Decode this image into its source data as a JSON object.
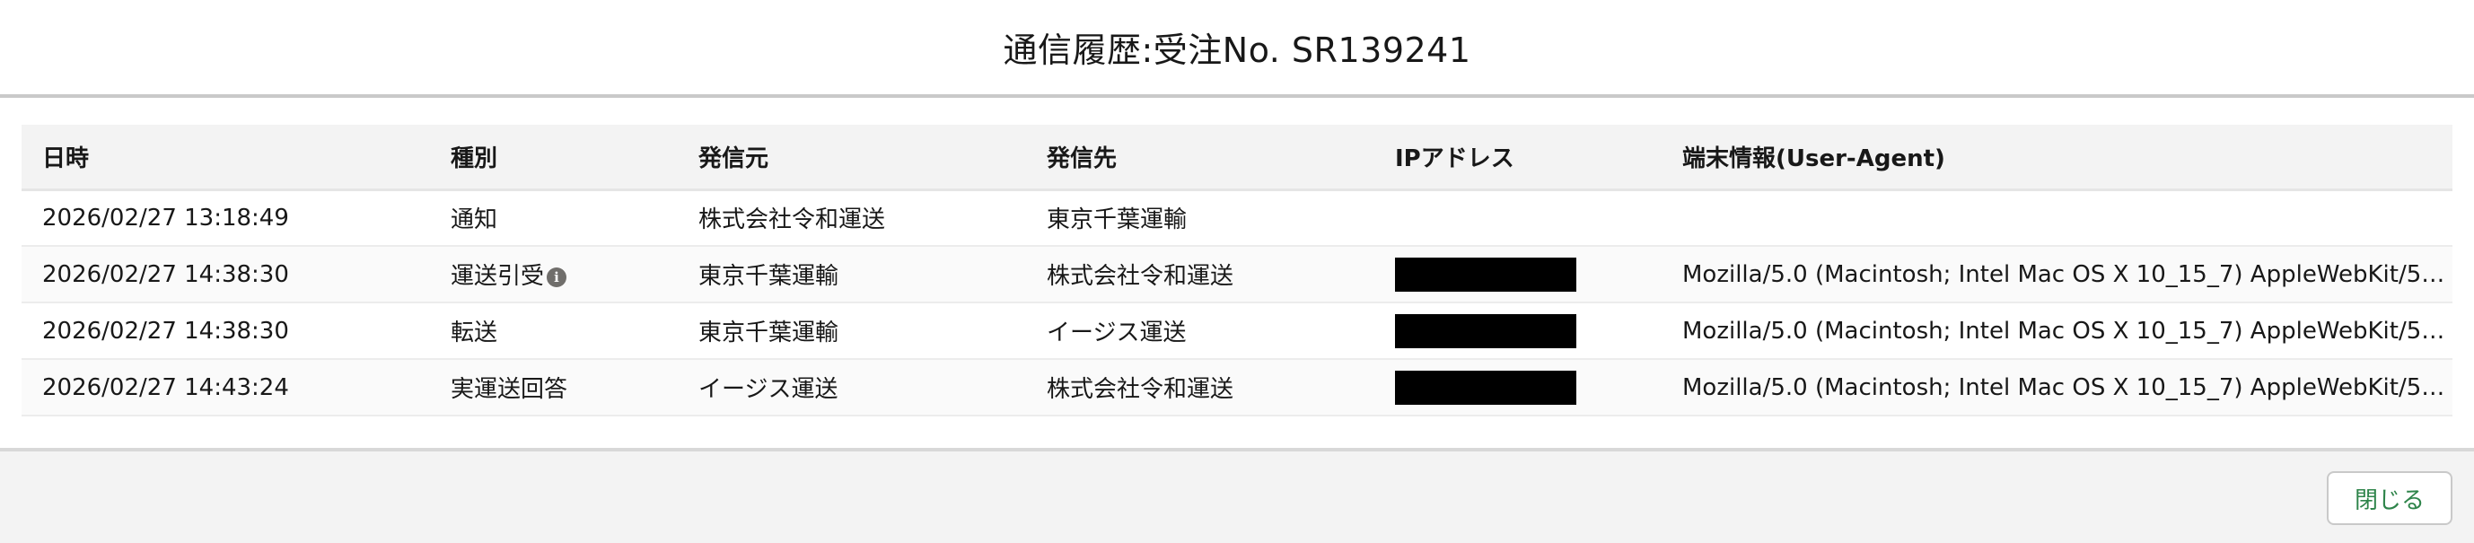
{
  "modal": {
    "title": "通信履歴:受注No. SR139241",
    "close_label": "閉じる"
  },
  "table": {
    "columns": [
      "日時",
      "種別",
      "発信元",
      "発信先",
      "IPアドレス",
      "端末情報(User-Agent)"
    ],
    "rows": [
      {
        "datetime": "2026/02/27 13:18:49",
        "type": "通知",
        "sender": "株式会社令和運送",
        "recipient": "東京千葉運輸",
        "ip_redacted": false,
        "user_agent": ""
      },
      {
        "datetime": "2026/02/27 14:38:30",
        "type": "運送引受",
        "type_icon": "info-icon",
        "sender": "東京千葉運輸",
        "recipient": "株式会社令和運送",
        "ip_redacted": true,
        "user_agent": "Mozilla/5.0 (Macintosh; Intel Mac OS X 10_15_7) AppleWebKit/537...."
      },
      {
        "datetime": "2026/02/27 14:38:30",
        "type": "転送",
        "sender": "東京千葉運輸",
        "recipient": "イージス運送",
        "ip_redacted": true,
        "user_agent": "Mozilla/5.0 (Macintosh; Intel Mac OS X 10_15_7) AppleWebKit/537...."
      },
      {
        "datetime": "2026/02/27 14:43:24",
        "type": "実運送回答",
        "sender": "イージス運送",
        "recipient": "株式会社令和運送",
        "ip_redacted": true,
        "user_agent": "Mozilla/5.0 (Macintosh; Intel Mac OS X 10_15_7) AppleWebKit/537...."
      }
    ]
  },
  "colors": {
    "header_bg": "#f3f3f3",
    "footer_bg": "#f3f3f3",
    "close_text": "#2e844a",
    "redaction": "#000000"
  }
}
